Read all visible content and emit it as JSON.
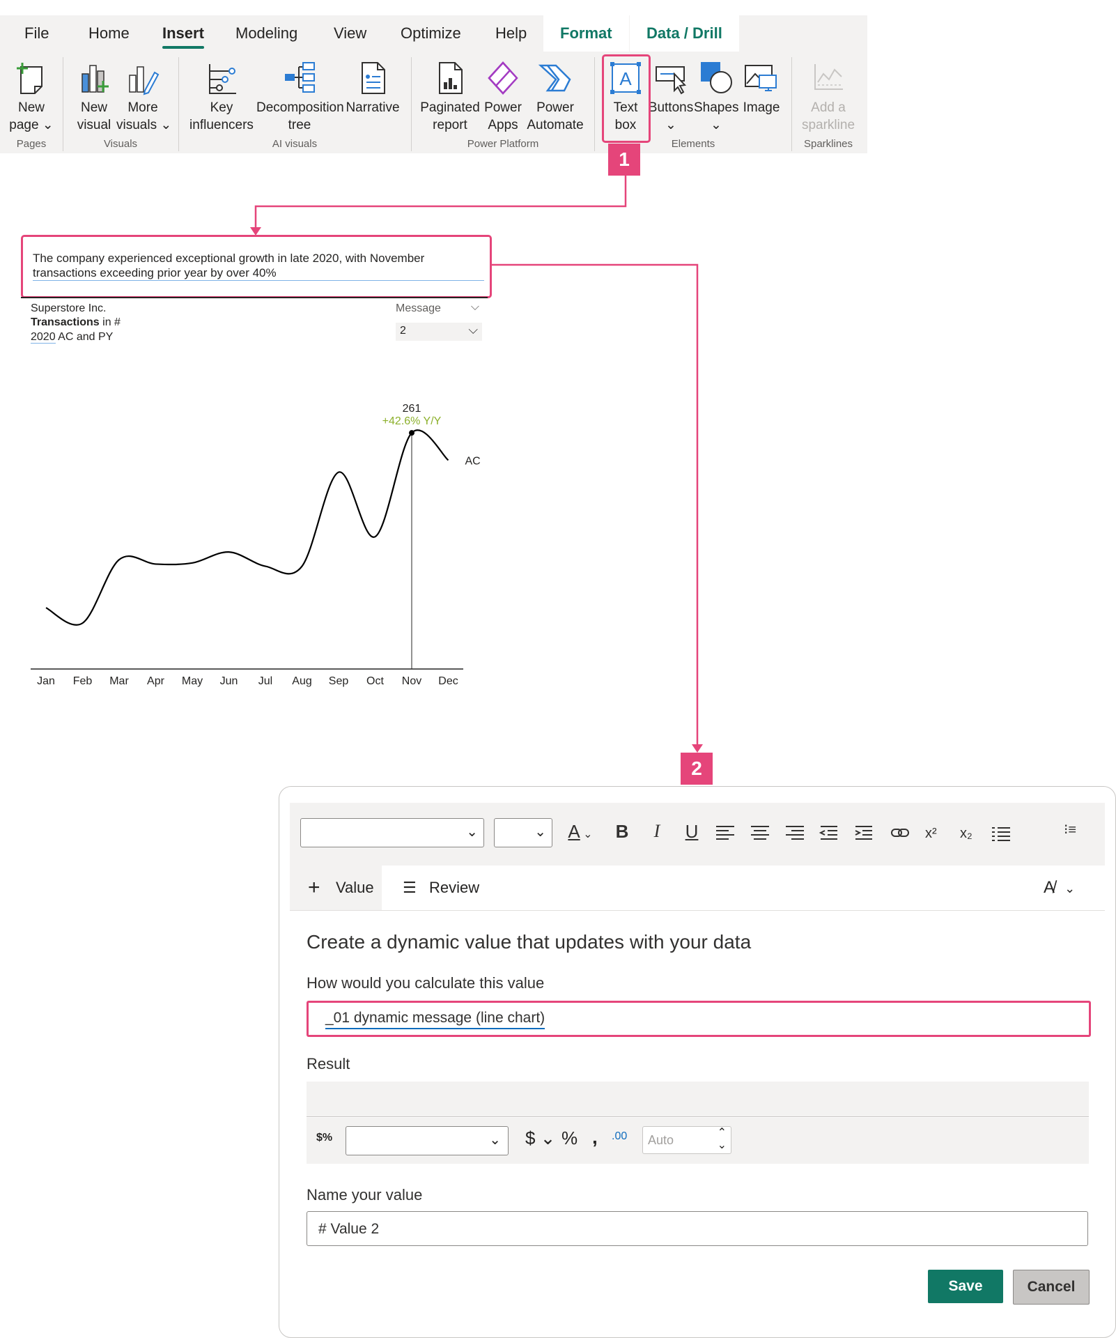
{
  "ribbon": {
    "tabs": [
      "File",
      "Home",
      "Insert",
      "Modeling",
      "View",
      "Optimize",
      "Help",
      "Format",
      "Data / Drill"
    ],
    "buttons": {
      "new_page": [
        "New",
        "page"
      ],
      "new_visual": [
        "New",
        "visual"
      ],
      "more_visuals": [
        "More",
        "visuals"
      ],
      "key_influencers": [
        "Key",
        "influencers"
      ],
      "decomposition_tree": [
        "Decomposition",
        "tree"
      ],
      "narrative": [
        "Narrative"
      ],
      "paginated_report": [
        "Paginated",
        "report"
      ],
      "power_apps": [
        "Power",
        "Apps"
      ],
      "power_automate": [
        "Power",
        "Automate"
      ],
      "text_box": [
        "Text",
        "box"
      ],
      "buttons": [
        "Buttons"
      ],
      "shapes": [
        "Shapes"
      ],
      "image": [
        "Image"
      ],
      "add_sparkline": [
        "Add a",
        "sparkline"
      ]
    },
    "groups": [
      "Pages",
      "Visuals",
      "AI visuals",
      "Power Platform",
      "Elements",
      "Sparklines"
    ]
  },
  "callouts": {
    "one": "1",
    "two": "2"
  },
  "colors": {
    "accent": "#117865",
    "callout": "#e5457a",
    "highlight_green": "#8cb02b"
  },
  "textbox": {
    "line1": "The company experienced exceptional growth in late 2020, with November",
    "line2": "transactions exceeding prior year by over 40%"
  },
  "visual": {
    "subtitle1": "Superstore Inc.",
    "subtitle2_bold": "Transactions",
    "subtitle2_rest": " in #",
    "subtitle3_year": "2020",
    "subtitle3_rest": " AC and PY",
    "slicer_label": "Message",
    "slicer_value": "2",
    "peak_value": "261",
    "peak_delta": "+42.6% Y/Y",
    "series_label": "AC"
  },
  "chart_data": {
    "type": "line",
    "title": "",
    "categories": [
      "Jan",
      "Feb",
      "Mar",
      "Apr",
      "May",
      "Jun",
      "Jul",
      "Aug",
      "Sep",
      "Oct",
      "Nov",
      "Dec"
    ],
    "series": [
      {
        "name": "AC",
        "values": [
          101,
          87,
          145,
          141,
          142,
          152,
          139,
          139,
          225,
          166,
          261,
          236
        ]
      }
    ],
    "annotations": [
      {
        "category": "Nov",
        "value": "261",
        "delta": "+42.6% Y/Y"
      }
    ],
    "grid": false,
    "legend": "none",
    "ylim": [
      45,
      300
    ]
  },
  "dialog": {
    "tabs": {
      "value": "Value",
      "review": "Review"
    },
    "heading": "Create a dynamic value that updates with your data",
    "calc_label": "How would you calculate this value",
    "calc_value": "_01 dynamic message (line chart)",
    "result_label": "Result",
    "auto_placeholder": "Auto",
    "name_label": "Name your value",
    "name_value": "# Value 2",
    "save": "Save",
    "cancel": "Cancel"
  }
}
